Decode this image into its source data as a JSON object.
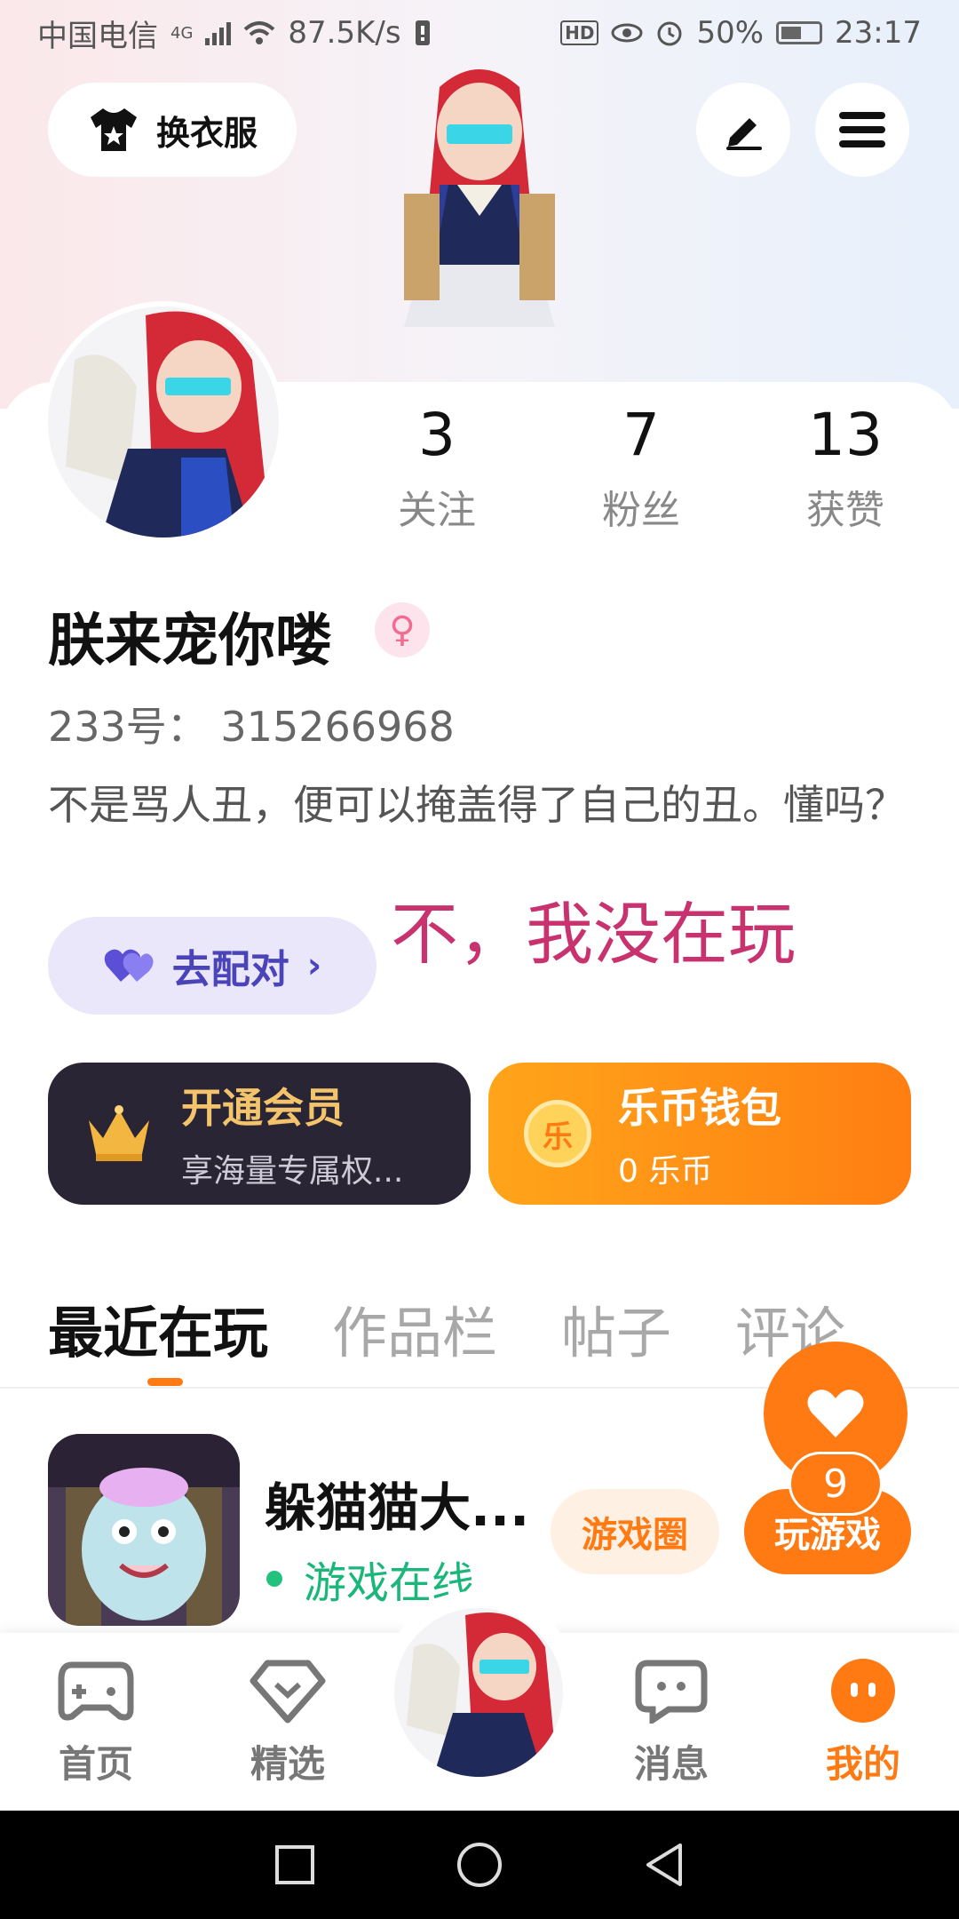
{
  "status_bar": {
    "carrier": "中国电信",
    "network": "4G",
    "speed": "87.5K/s",
    "hd": "HD",
    "battery": "50%",
    "time": "23:17"
  },
  "header": {
    "outfit_label": "换衣服",
    "edit_icon": "pencil-icon",
    "menu_icon": "menu-icon"
  },
  "stats": [
    {
      "value": "3",
      "label": "关注"
    },
    {
      "value": "7",
      "label": "粉丝"
    },
    {
      "value": "13",
      "label": "获赞"
    }
  ],
  "profile": {
    "nickname": "朕来宠你喽",
    "gender_symbol": "♀",
    "uid": "233号：  315266968",
    "bio": "不是骂人丑，便可以掩盖得了自己的丑。懂吗？",
    "pair_label": "去配对",
    "overlay_text": "不，我没在玩"
  },
  "cards": {
    "vip": {
      "title": "开通会员",
      "sub": "享海量专属权..."
    },
    "wallet": {
      "title": "乐币钱包",
      "sub": "0 乐币",
      "coin": "乐"
    }
  },
  "tabs": [
    "最近在玩",
    "作品栏",
    "帖子",
    "评论"
  ],
  "game": {
    "name": "躲猫猫大...",
    "status": "游戏在线",
    "circle_label": "游戏圈",
    "play_label": "玩游戏",
    "like_count": "9"
  },
  "bottom_nav": [
    {
      "label": "首页",
      "icon": "gamepad-icon"
    },
    {
      "label": "精选",
      "icon": "heart-gem-icon"
    },
    {
      "label": "消息",
      "icon": "chat-icon"
    },
    {
      "label": "我的",
      "icon": "face-icon"
    }
  ],
  "colors": {
    "accent": "#ff7a12",
    "pair": "#4b44b8",
    "online": "#1ab67a",
    "overlay": "#c8336f"
  }
}
